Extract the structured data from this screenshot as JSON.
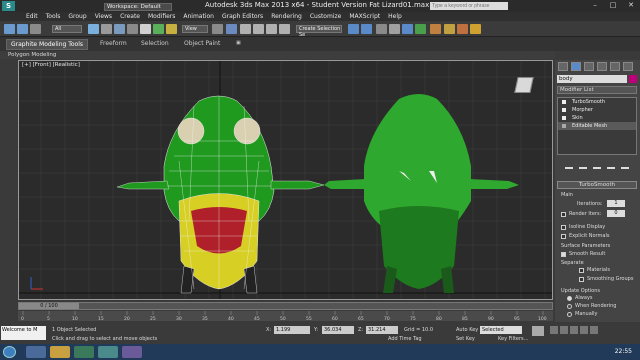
{
  "titlebar": {
    "workspace": "Workspace: Default",
    "title": "Autodesk 3ds Max  2013 x64  -  Student Version   Fat Lizard01.max",
    "search_placeholder": "Type a keyword or phrase"
  },
  "menu": [
    "Edit",
    "Tools",
    "Group",
    "Views",
    "Create",
    "Modifiers",
    "Animation",
    "Graph Editors",
    "Rendering",
    "Customize",
    "MAXScript",
    "Help"
  ],
  "toolbar": {
    "selection_filter": "All",
    "ref_coord": "View",
    "named_selection": "Create Selection Se"
  },
  "ribbon": {
    "tabs": [
      "Graphite Modeling Tools",
      "Freeform",
      "Selection",
      "Object Paint"
    ],
    "subpanel": "Polygon Modeling"
  },
  "viewport": {
    "label": "[+] [Front] [Realistic]",
    "viewcube_label": ""
  },
  "command_panel": {
    "object_name": "body",
    "object_color": "#c0007a",
    "modifier_list": "Modifier List",
    "stack": [
      "TurboSmooth",
      "Morpher",
      "Skin",
      "Editable Mesh"
    ],
    "rollout_title": "TurboSmooth",
    "main_label": "Main",
    "iterations_label": "Iterations:",
    "iterations_value": "1",
    "render_iters_label": "Render Iters:",
    "render_iters_value": "0",
    "isoline": "Isoline Display",
    "explicit_normals": "Explicit Normals",
    "surface_params": "Surface Parameters",
    "smooth_result": "Smooth Result",
    "separate": "Separate",
    "materials": "Materials",
    "smoothing_groups": "Smoothing Groups",
    "update_options": "Update Options",
    "always": "Always",
    "when_rendering": "When Rendering",
    "manually": "Manually"
  },
  "timeline": {
    "slider": "0 / 100",
    "ticks": [
      "0",
      "5",
      "10",
      "15",
      "20",
      "25",
      "30",
      "35",
      "40",
      "45",
      "50",
      "55",
      "60",
      "65",
      "70",
      "75",
      "80",
      "85",
      "90",
      "95",
      "100"
    ]
  },
  "status": {
    "maxscript": "Welcome to M",
    "selected": "1 Object Selected",
    "prompt": "Click and drag to select and move objects",
    "x_label": "X:",
    "x": "1.199",
    "y_label": "Y:",
    "y": "36.034",
    "z_label": "Z:",
    "z": "31.214",
    "grid": "Grid = 10.0",
    "auto_key": "Auto Key",
    "selected_dropdown": "Selected",
    "set_key": "Set Key",
    "key_filters": "Key Filters...",
    "add_time_tag": "Add Time Tag"
  },
  "taskbar": {
    "clock": "22:55"
  }
}
